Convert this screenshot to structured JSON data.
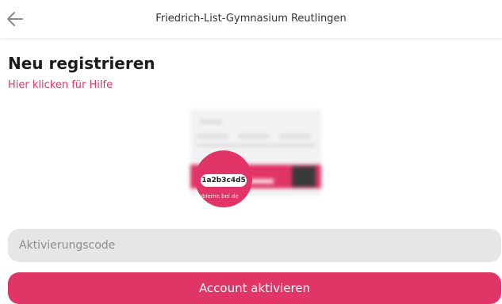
{
  "header": {
    "title": "Friedrich-List-Gymnasium Reutlingen",
    "back_icon": "arrow-left-icon"
  },
  "page": {
    "title": "Neu registrieren",
    "help_link": "Hier klicken für Hilfe"
  },
  "illustration": {
    "code": "1a2b3c4d5",
    "hint_text": "Probleme bei de"
  },
  "form": {
    "code_placeholder": "Aktivierungscode",
    "code_value": "",
    "submit_label": "Account aktivieren"
  },
  "colors": {
    "accent": "#e03566",
    "input_bg": "#e6e6e8"
  }
}
